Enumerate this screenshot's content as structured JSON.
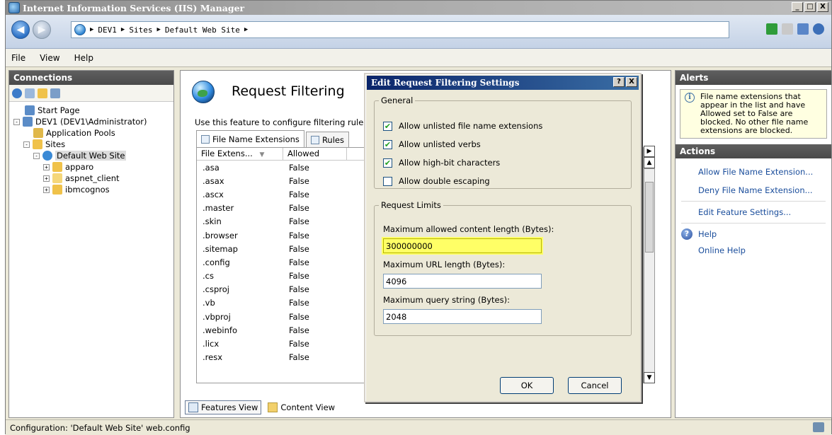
{
  "window": {
    "title": "Internet Information Services (IIS) Manager",
    "buttons": {
      "minimize": "_",
      "maximize": "□",
      "close": "X"
    }
  },
  "address": {
    "crumbs": [
      "DEV1",
      "Sites",
      "Default Web Site"
    ]
  },
  "menu": [
    "File",
    "View",
    "Help"
  ],
  "connections": {
    "title": "Connections",
    "tree": [
      {
        "label": "Start Page"
      },
      {
        "label": "DEV1 (DEV1\\Administrator)",
        "expander": "-"
      },
      {
        "label": "Application Pools"
      },
      {
        "label": "Sites",
        "expander": "-"
      },
      {
        "label": "Default Web Site",
        "expander": "-"
      },
      {
        "label": "apparo",
        "expander": "+"
      },
      {
        "label": "aspnet_client",
        "expander": "+"
      },
      {
        "label": "ibmcognos",
        "expander": "+"
      }
    ]
  },
  "feature": {
    "title": "Request Filtering",
    "description": "Use this feature to configure filtering rules.",
    "tabs": [
      "File Name Extensions",
      "Rules"
    ],
    "columns": [
      "File Extens...",
      "Allowed"
    ],
    "rows": [
      {
        "ext": ".asa",
        "allowed": "False"
      },
      {
        "ext": ".asax",
        "allowed": "False"
      },
      {
        "ext": ".ascx",
        "allowed": "False"
      },
      {
        "ext": ".master",
        "allowed": "False"
      },
      {
        "ext": ".skin",
        "allowed": "False"
      },
      {
        "ext": ".browser",
        "allowed": "False"
      },
      {
        "ext": ".sitemap",
        "allowed": "False"
      },
      {
        "ext": ".config",
        "allowed": "False"
      },
      {
        "ext": ".cs",
        "allowed": "False"
      },
      {
        "ext": ".csproj",
        "allowed": "False"
      },
      {
        "ext": ".vb",
        "allowed": "False"
      },
      {
        "ext": ".vbproj",
        "allowed": "False"
      },
      {
        "ext": ".webinfo",
        "allowed": "False"
      },
      {
        "ext": ".licx",
        "allowed": "False"
      },
      {
        "ext": ".resx",
        "allowed": "False"
      }
    ],
    "views": {
      "features": "Features View",
      "content": "Content View"
    }
  },
  "alerts": {
    "title": "Alerts",
    "text": "File name extensions that appear in the list and have Allowed set to False are blocked. No other file name extensions are blocked."
  },
  "actions": {
    "title": "Actions",
    "allow": "Allow File Name Extension...",
    "deny": "Deny File Name Extension...",
    "edit": "Edit Feature Settings...",
    "help": "Help",
    "online_help": "Online Help"
  },
  "dialog": {
    "title": "Edit Request Filtering Settings",
    "help_btn": "?",
    "close_btn": "X",
    "general": {
      "legend": "General",
      "options": [
        {
          "label": "Allow unlisted file name extensions",
          "checked": true
        },
        {
          "label": "Allow unlisted verbs",
          "checked": true
        },
        {
          "label": "Allow high-bit characters",
          "checked": true
        },
        {
          "label": "Allow double escaping",
          "checked": false
        }
      ]
    },
    "limits": {
      "legend": "Request Limits",
      "max_content_label": "Maximum allowed content length (Bytes):",
      "max_content_value": "300000000",
      "max_url_label": "Maximum URL length (Bytes):",
      "max_url_value": "4096",
      "max_query_label": "Maximum query string (Bytes):",
      "max_query_value": "2048"
    },
    "ok": "OK",
    "cancel": "Cancel"
  },
  "status": {
    "text": "Configuration: 'Default Web Site' web.config"
  },
  "colors": {
    "highlight": "#ffff66",
    "link": "#1b4e9c",
    "title_bar": "#0a246a"
  }
}
